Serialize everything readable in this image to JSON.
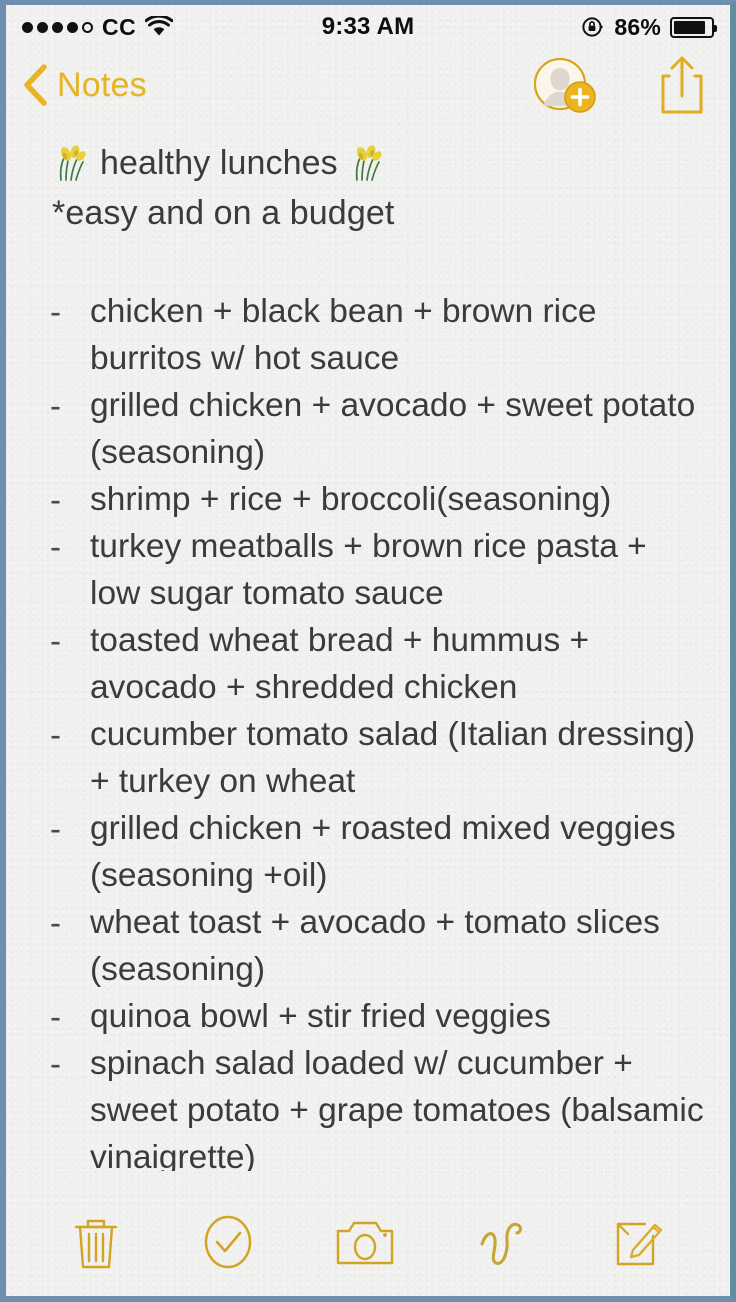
{
  "statusbar": {
    "signal_dots_total": 5,
    "signal_dots_filled": 4,
    "carrier": "CC",
    "wifi_icon": "wifi-icon",
    "time": "9:33 AM",
    "rotation_lock_icon": "rotation-lock-icon",
    "battery_percent": "86%",
    "battery_level": 86
  },
  "navbar": {
    "back_label": "Notes",
    "back_icon": "chevron-left-icon",
    "add_person_icon": "add-person-icon",
    "share_icon": "share-icon"
  },
  "note": {
    "title_emoji_left": "sheaf-of-rice-emoji",
    "title": "healthy lunches",
    "title_emoji_right": "sheaf-of-rice-emoji",
    "subtitle": "*easy and on a budget",
    "bullet_marker": "-",
    "items": [
      "chicken + black bean + brown rice burritos w/ hot sauce",
      "grilled chicken + avocado + sweet potato (seasoning)",
      "shrimp + rice + broccoli(seasoning)",
      "turkey meatballs + brown rice pasta + low sugar tomato sauce",
      "toasted wheat bread + hummus + avocado + shredded chicken",
      "cucumber tomato salad (Italian dressing) + turkey on wheat",
      "grilled chicken + roasted mixed veggies (seasoning +oil)",
      "wheat toast + avocado + tomato slices (seasoning)",
      "quinoa bowl + stir fried veggies",
      "spinach salad loaded w/ cucumber + sweet potato + grape tomatoes (balsamic vinaigrette)"
    ]
  },
  "toolbar": {
    "items": [
      {
        "name": "delete-button",
        "icon": "trash-icon"
      },
      {
        "name": "checklist-button",
        "icon": "check-circle-icon"
      },
      {
        "name": "camera-button",
        "icon": "camera-icon"
      },
      {
        "name": "sketch-button",
        "icon": "squiggle-icon"
      },
      {
        "name": "compose-button",
        "icon": "compose-icon"
      }
    ]
  },
  "colors": {
    "accent": "#e8b423",
    "text": "#3b3b3b",
    "paper": "#f2f2f0",
    "frame": "#6f8fb0"
  }
}
